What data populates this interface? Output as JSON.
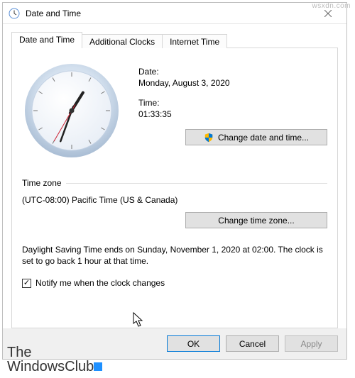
{
  "window": {
    "title": "Date and Time",
    "tabs": [
      "Date and Time",
      "Additional Clocks",
      "Internet Time"
    ]
  },
  "dateSection": {
    "dateLabel": "Date:",
    "dateValue": "Monday, August 3, 2020",
    "timeLabel": "Time:",
    "timeValue": "01:33:35",
    "changeDateTimeBtn": "Change date and time..."
  },
  "tzSection": {
    "heading": "Time zone",
    "value": "(UTC-08:00) Pacific Time (US & Canada)",
    "changeTzBtn": "Change time zone..."
  },
  "dstText": "Daylight Saving Time ends on Sunday, November 1, 2020 at 02:00. The clock is set to go back 1 hour at that time.",
  "notify": {
    "checked": true,
    "label": "Notify me when the clock changes"
  },
  "buttons": {
    "ok": "OK",
    "cancel": "Cancel",
    "apply": "Apply"
  },
  "watermark": {
    "site": "wsxdn.com",
    "brand1": "The",
    "brand2": "WindowsClub"
  },
  "clock": {
    "hourAngle": 32,
    "minuteAngle": 200,
    "secondAngle": 210
  },
  "colors": {
    "buttonFace": "#e1e1e1",
    "accent": "#0078d7"
  }
}
